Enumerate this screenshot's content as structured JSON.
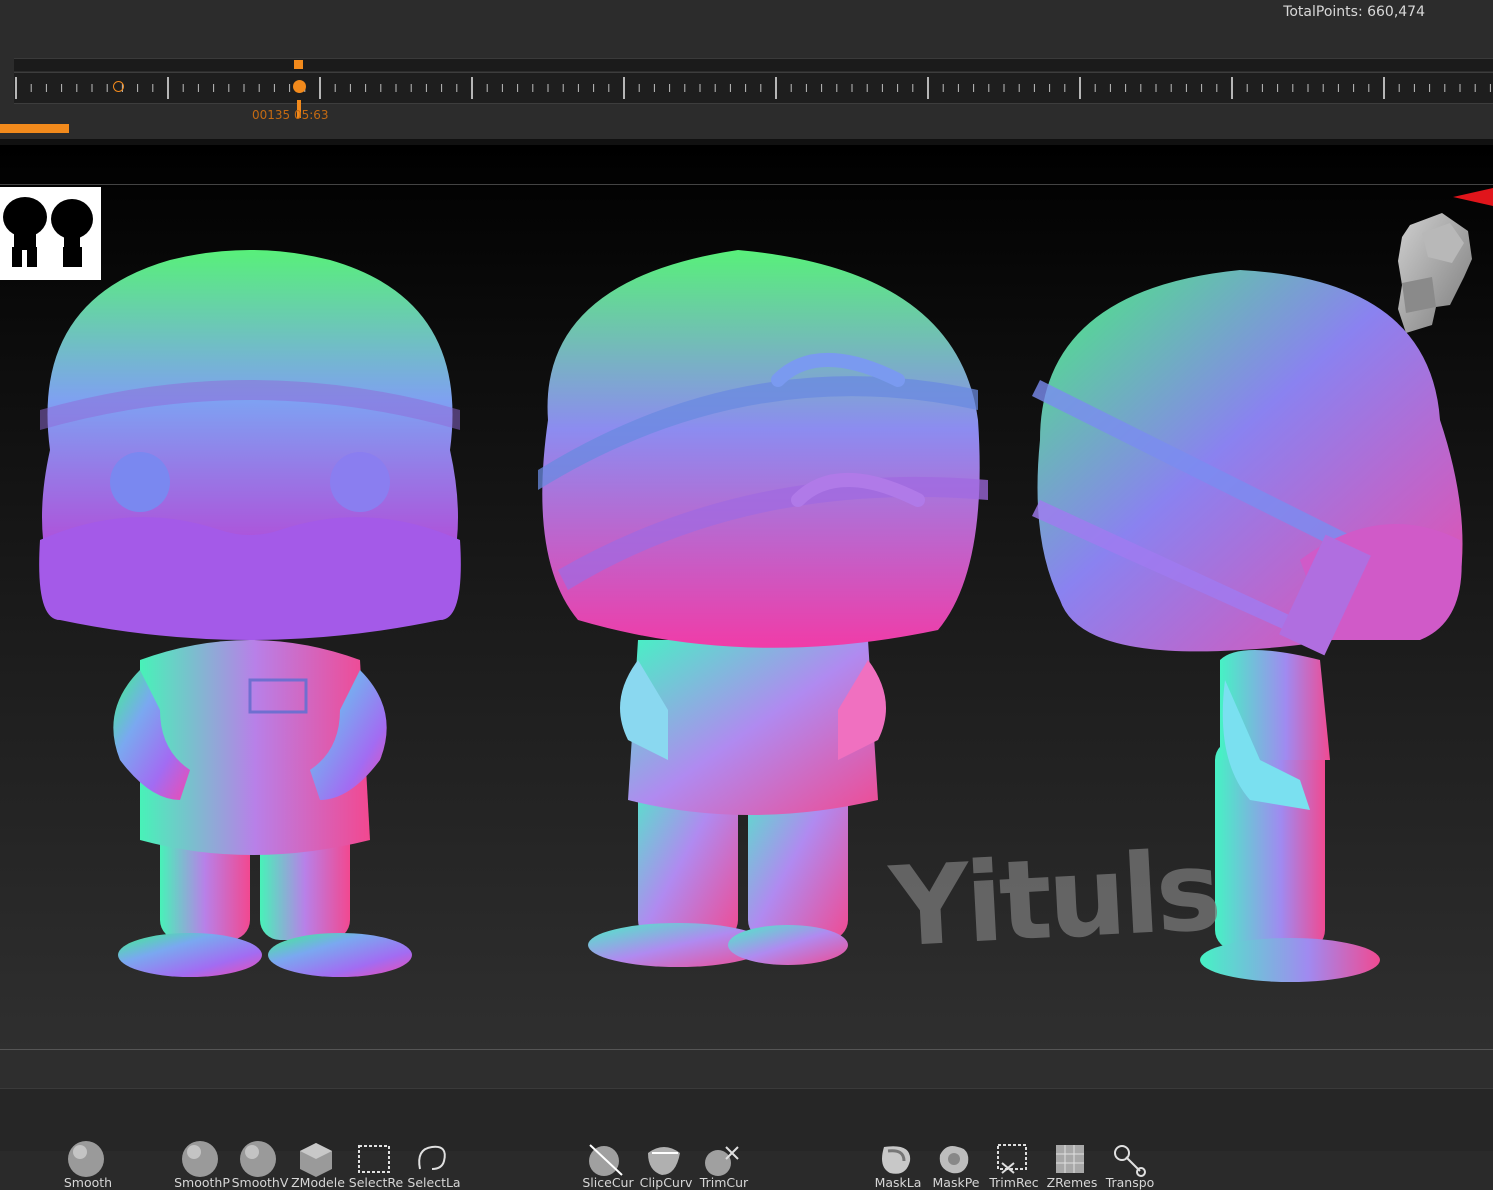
{
  "header": {
    "total_points": "TotalPoints: 660,474"
  },
  "timeline": {
    "frame_label": "00135  05:63",
    "playhead_position": 0.19,
    "keyframe_position": 0.068,
    "progress_fraction": 0.046,
    "accent_color": "#f28a1c"
  },
  "viewport": {
    "watermark": "Yituls",
    "figures": [
      {
        "name": "front-view",
        "shading": "normal-map"
      },
      {
        "name": "back-view",
        "shading": "normal-map"
      },
      {
        "name": "side-view",
        "shading": "normal-map"
      }
    ],
    "navigator_icon": "head-navigator-icon",
    "thumbnail_icon": "silhouette-thumbnail-icon"
  },
  "shelf": {
    "tools": [
      {
        "label": "Smooth",
        "icon": "sphere-brush-icon"
      },
      {
        "label": "SmoothP",
        "icon": "sphere-brush-icon"
      },
      {
        "label": "SmoothV",
        "icon": "sphere-brush-icon"
      },
      {
        "label": "ZModele",
        "icon": "zmodeler-cube-icon"
      },
      {
        "label": "SelectRe",
        "icon": "select-rect-icon"
      },
      {
        "label": "SelectLa",
        "icon": "select-lasso-icon"
      },
      {
        "label": "SliceCur",
        "icon": "slice-curve-icon"
      },
      {
        "label": "ClipCurv",
        "icon": "clip-curve-icon"
      },
      {
        "label": "TrimCur",
        "icon": "trim-curve-icon"
      },
      {
        "label": "MaskLa",
        "icon": "mask-lasso-icon"
      },
      {
        "label": "MaskPe",
        "icon": "mask-pen-icon"
      },
      {
        "label": "TrimRec",
        "icon": "trim-rect-icon"
      },
      {
        "label": "ZRemes",
        "icon": "zremesher-icon"
      },
      {
        "label": "Transpo",
        "icon": "transpose-icon"
      }
    ]
  }
}
